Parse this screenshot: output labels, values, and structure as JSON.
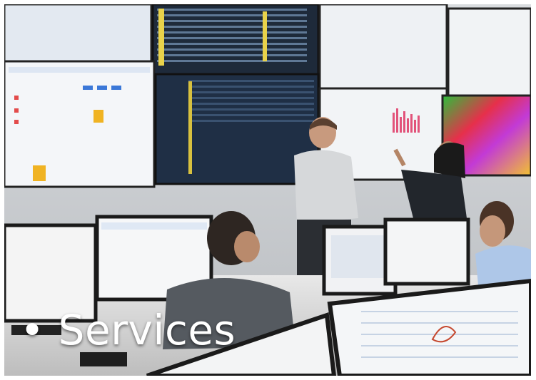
{
  "caption": {
    "bullet": "•",
    "text": "Services"
  },
  "colors": {
    "caption": "#ffffff",
    "wall": "#c9ccd0",
    "screen_dark": "#1f2f45",
    "screen_light": "#f2f4f6",
    "heatmap_hot": "#e6304a"
  }
}
